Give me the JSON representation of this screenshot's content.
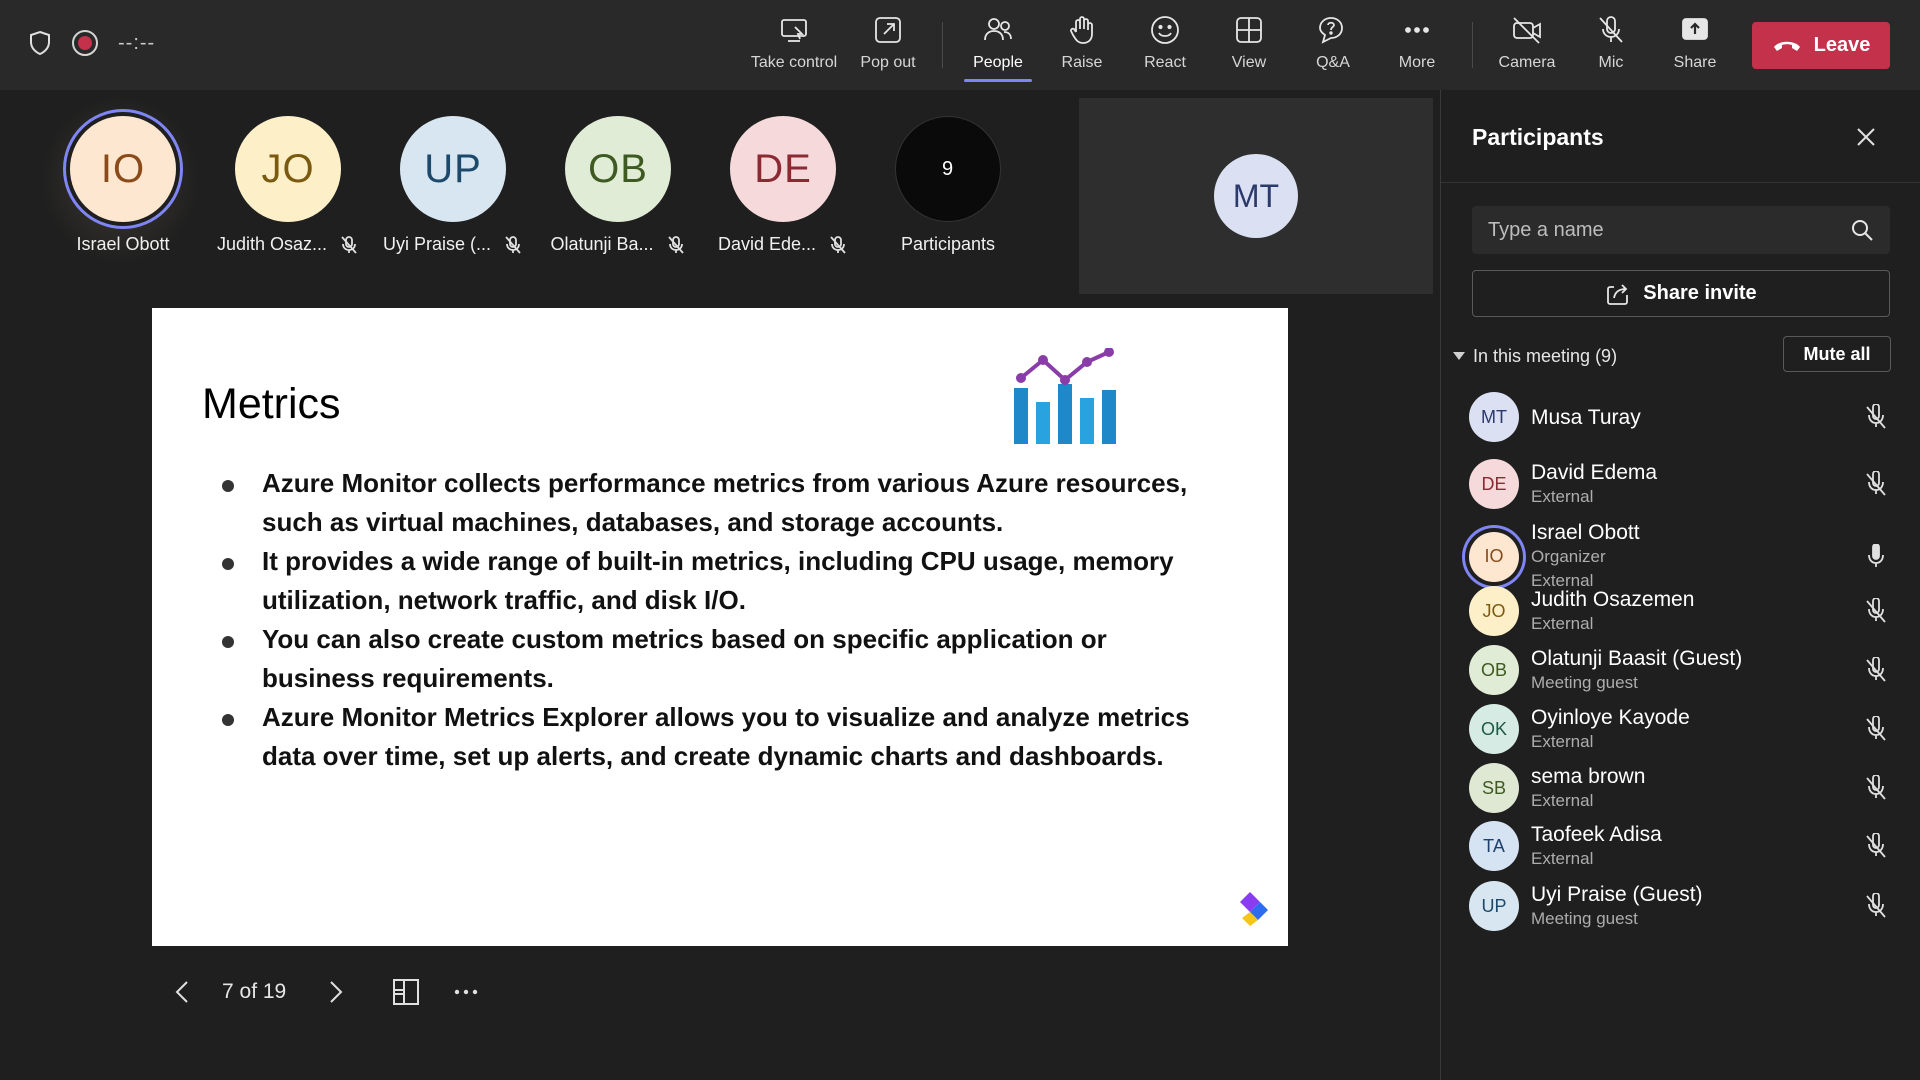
{
  "topbar": {
    "timer": "--:--",
    "buttons": {
      "take_control": "Take control",
      "pop_out": "Pop out",
      "people": "People",
      "raise": "Raise",
      "react": "React",
      "view": "View",
      "qa": "Q&A",
      "more": "More",
      "camera": "Camera",
      "mic": "Mic",
      "share": "Share"
    },
    "leave": "Leave",
    "accent": "#7f85f5",
    "leave_color": "#c4314b"
  },
  "strip": {
    "tiles": [
      {
        "initials": "IO",
        "name": "Israel Obott",
        "bg": "#fde7d0",
        "fg": "#8a4b1a"
      },
      {
        "initials": "JO",
        "name": "Judith Osaz...",
        "bg": "#fdf0c9",
        "fg": "#7a5a10"
      },
      {
        "initials": "UP",
        "name": "Uyi Praise (...",
        "bg": "#d7e6f0",
        "fg": "#1d4a6b"
      },
      {
        "initials": "OB",
        "name": "Olatunji Ba...",
        "bg": "#e1ecd6",
        "fg": "#3e5a22"
      },
      {
        "initials": "DE",
        "name": "David Ede...",
        "bg": "#f6d9db",
        "fg": "#8a2a33"
      }
    ],
    "count": "9",
    "count_label": "Participants",
    "video_tile": {
      "initials": "MT",
      "bg": "#dbe1f2",
      "fg": "#2b3a6b"
    }
  },
  "slide": {
    "title": "Metrics",
    "bullets": [
      "Azure Monitor collects performance metrics from various Azure resources, such as virtual machines, databases, and storage accounts.",
      "It provides a wide range of built-in metrics, including CPU usage, memory utilization, network traffic, and disk I/O.",
      "You can also create custom metrics based on specific application or business requirements.",
      "Azure Monitor Metrics Explorer allows you to visualize and analyze metrics data over time, set up alerts, and create dynamic charts and dashboards."
    ],
    "counter": "7 of 19"
  },
  "panel": {
    "title": "Participants",
    "search_placeholder": "Type a name",
    "share_invite": "Share invite",
    "section_label": "In this meeting (9)",
    "mute_all": "Mute all",
    "participants": [
      {
        "initials": "MT",
        "name": "Musa Turay",
        "sub1": "",
        "sub2": "",
        "bg": "#dbe1f2",
        "fg": "#2b3a6b",
        "muted": true
      },
      {
        "initials": "DE",
        "name": "David Edema",
        "sub1": "External",
        "sub2": "",
        "bg": "#f6d9db",
        "fg": "#8a2a33",
        "muted": true
      },
      {
        "initials": "IO",
        "name": "Israel Obott",
        "sub1": "Organizer",
        "sub2": "External",
        "bg": "#fde7d0",
        "fg": "#8a4b1a",
        "muted": false
      },
      {
        "initials": "JO",
        "name": "Judith Osazemen",
        "sub1": "External",
        "sub2": "",
        "bg": "#fdf0c9",
        "fg": "#7a5a10",
        "muted": true
      },
      {
        "initials": "OB",
        "name": "Olatunji Baasit (Guest)",
        "sub1": "Meeting guest",
        "sub2": "",
        "bg": "#e1ecd6",
        "fg": "#3e5a22",
        "muted": true
      },
      {
        "initials": "OK",
        "name": "Oyinloye Kayode",
        "sub1": "External",
        "sub2": "",
        "bg": "#d6ebe4",
        "fg": "#1f5a44",
        "muted": true
      },
      {
        "initials": "SB",
        "name": "sema brown",
        "sub1": "External",
        "sub2": "",
        "bg": "#dfe8d3",
        "fg": "#3e5a22",
        "muted": true
      },
      {
        "initials": "TA",
        "name": "Taofeek Adisa",
        "sub1": "External",
        "sub2": "",
        "bg": "#d6e3f3",
        "fg": "#1d3f6b",
        "muted": true
      },
      {
        "initials": "UP",
        "name": "Uyi Praise (Guest)",
        "sub1": "Meeting guest",
        "sub2": "",
        "bg": "#d7e6f0",
        "fg": "#1d4a6b",
        "muted": true
      }
    ]
  }
}
